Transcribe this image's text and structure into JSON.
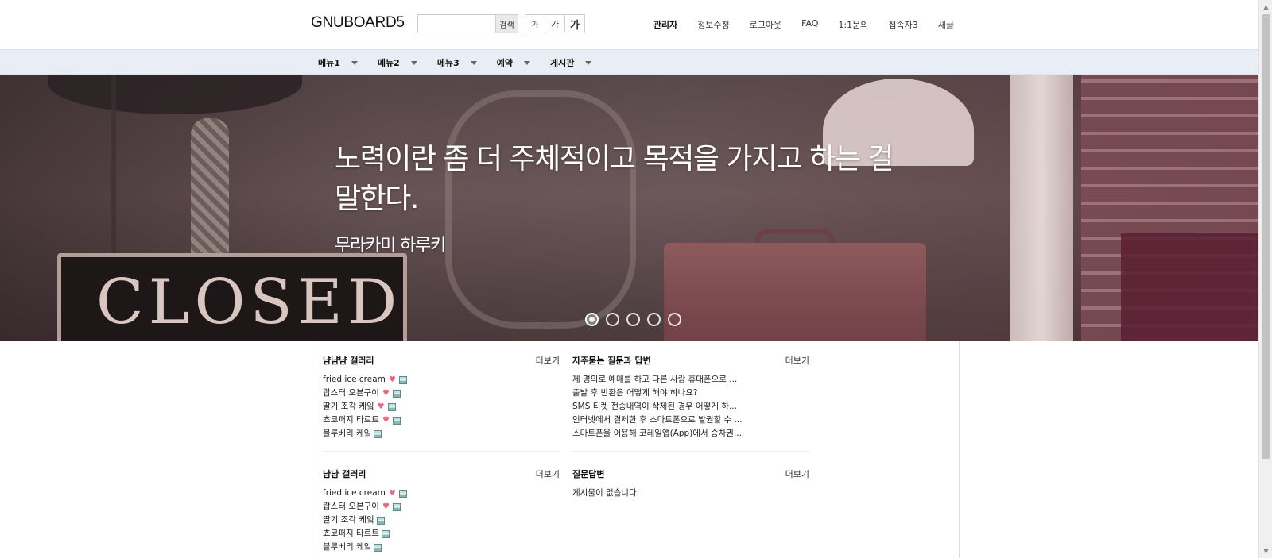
{
  "header": {
    "logo": "GNUBOARD5",
    "search_placeholder": "",
    "search_button": "검색",
    "font_buttons": [
      "가",
      "가",
      "가"
    ],
    "links": [
      "관리자",
      "정보수정",
      "로그아웃",
      "FAQ",
      "1:1문의",
      "접속자3",
      "새글"
    ]
  },
  "nav": {
    "items": [
      "메뉴1",
      "메뉴2",
      "메뉴3",
      "예약",
      "게시판"
    ]
  },
  "hero": {
    "quote": "노력이란 좀 더 주체적이고 목적을 가지고 하는 걸 말한다.",
    "author": "무라카미 하루키",
    "sign_text": "CLOSED",
    "slide_count": 5,
    "active_slide": 1
  },
  "boxes": {
    "gallery1": {
      "title": "냠냠냠 갤러리",
      "more": "더보기",
      "items": [
        "fried ice cream",
        "랍스터 오븐구이",
        "딸기 조각 케잌",
        "쵸코퍼지 타르트",
        "블루베리 케잌"
      ]
    },
    "faq": {
      "title": "자주묻는 질문과 답변",
      "more": "더보기",
      "items": [
        "제 명의로 예매를 하고 다른 사람 휴대폰으로 ...",
        "출발 후 반환은 어떻게 해야 하나요?",
        "SMS 티켓 전송내역이 삭제된 경우 어떻게 하...",
        "인터넷에서 결제한 후 스마트폰으로 발권할 수 ...",
        "스마트폰을 이용해 코레일앱(App)에서 승차권..."
      ]
    },
    "gallery2": {
      "title": "냠냠 갤러리",
      "more": "더보기",
      "items": [
        "fried ice cream",
        "랍스터 오븐구이",
        "딸기 조각 케잌",
        "쵸코퍼지 타르트",
        "블루베리 케잌"
      ]
    },
    "qa": {
      "title": "질문답변",
      "more": "더보기",
      "empty": "게시물이 없습니다."
    }
  }
}
